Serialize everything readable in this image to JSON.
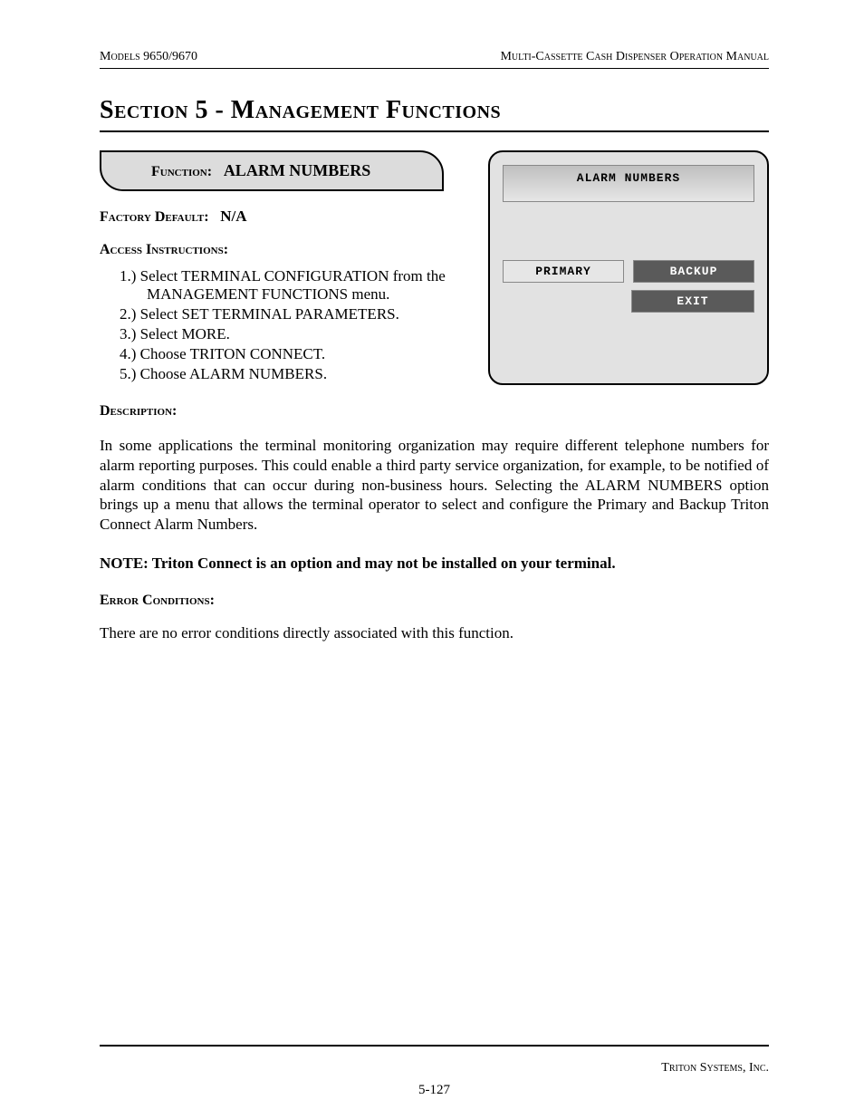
{
  "header": {
    "left": "Models 9650/9670",
    "right": "Multi-Cassette Cash Dispenser Operation Manual"
  },
  "section_title": "Section 5 - Management Functions",
  "function_box": {
    "label": "Function:",
    "name": "ALARM NUMBERS"
  },
  "factory_default": {
    "label": "Factory Default:",
    "value": "N/A"
  },
  "access_instructions": {
    "label": "Access Instructions:",
    "steps": [
      "Select TERMINAL CONFIGURATION from the MANAGEMENT FUNCTIONS menu.",
      "Select SET TERMINAL PARAMETERS.",
      "Select MORE.",
      "Choose TRITON CONNECT.",
      "Choose ALARM NUMBERS."
    ]
  },
  "screenshot": {
    "title": "ALARM NUMBERS",
    "buttons": {
      "primary": "PRIMARY",
      "backup": "BACKUP",
      "exit": "EXIT"
    }
  },
  "description": {
    "label": "Description:",
    "text": "In some applications the terminal monitoring organization may require different telephone numbers for alarm reporting purposes. This could enable a third party service organization, for example, to be notified of alarm conditions that can occur during non-business hours. Selecting the ALARM NUMBERS option brings up a menu that allows the terminal operator to select and configure the Primary and Backup Triton Connect Alarm Numbers."
  },
  "note": "NOTE: Triton Connect is an option and may not be installed on your terminal.",
  "error_conditions": {
    "label": "Error Conditions:",
    "text": "There are no error conditions directly associated with this function."
  },
  "footer": {
    "company": "Triton Systems, Inc.",
    "page": "5-127"
  }
}
